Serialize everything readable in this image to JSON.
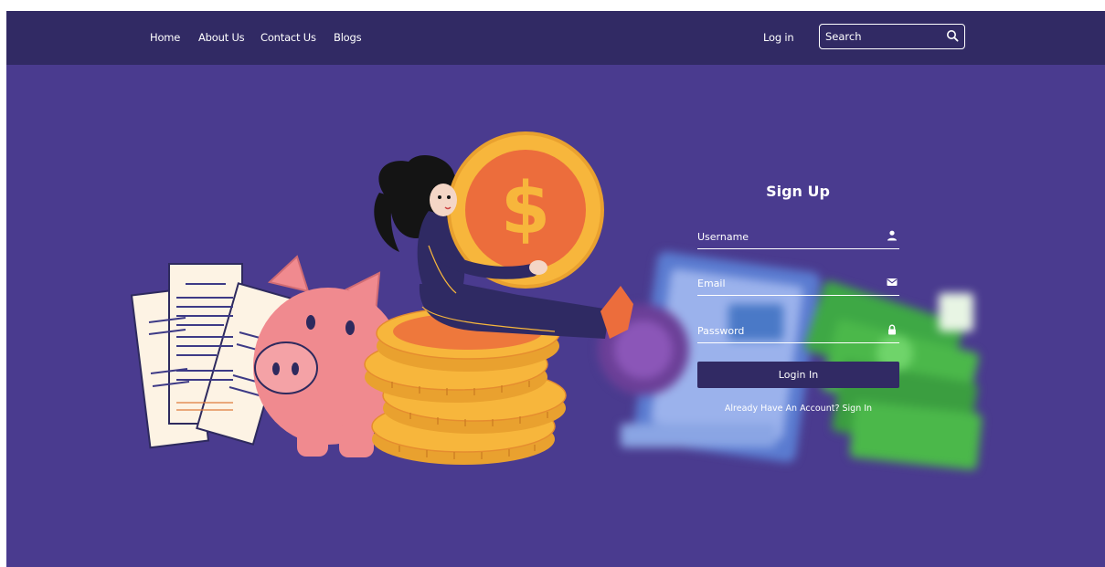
{
  "nav": {
    "links": [
      "Home",
      "About Us",
      "Contact Us",
      "Blogs"
    ],
    "login_label": "Log in",
    "search_placeholder": "Search"
  },
  "form": {
    "title": "Sign Up",
    "username_placeholder": "Username",
    "email_placeholder": "Email",
    "password_placeholder": "Password",
    "submit_label": "Login In",
    "account_link": "Already Have An Account? Sign In"
  },
  "icons": {
    "search": "search-icon",
    "username": "user-icon",
    "email": "envelope-icon",
    "password": "lock-icon"
  },
  "colors": {
    "background": "#4a3b8f",
    "navbar": "#312a64",
    "button": "#312a64",
    "coin": "#f7b63c",
    "coin_inner": "#ec6d3c",
    "piggy": "#f08a8f",
    "money": "#4bb84a"
  }
}
